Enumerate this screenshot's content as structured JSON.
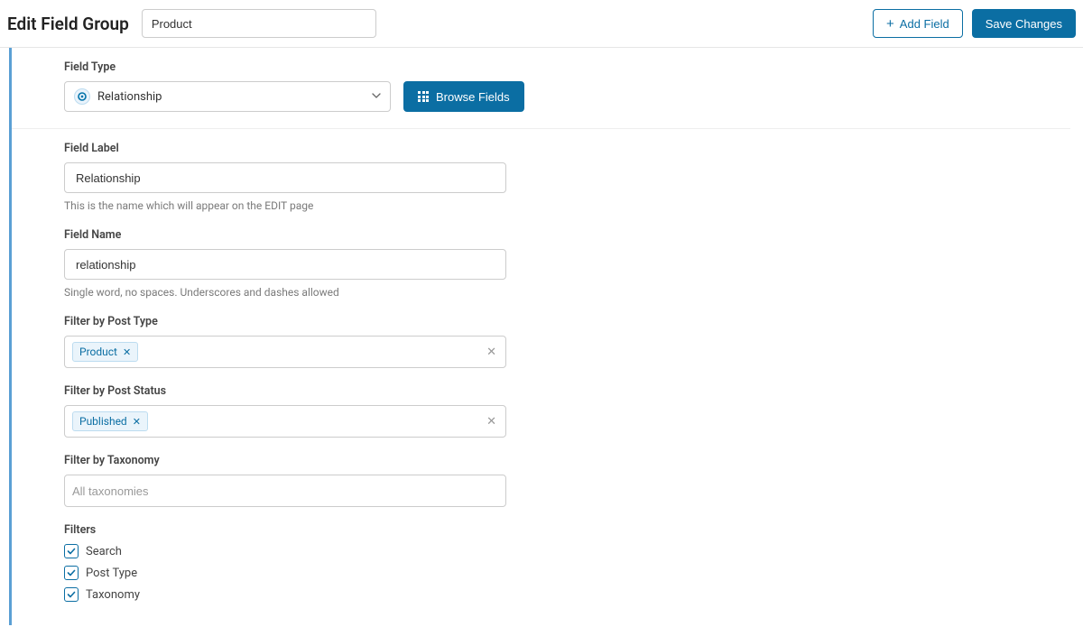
{
  "header": {
    "title": "Edit Field Group",
    "group_name": "Product",
    "add_field": "Add Field",
    "save_changes": "Save Changes"
  },
  "field_type": {
    "label": "Field Type",
    "selected": "Relationship",
    "browse": "Browse Fields"
  },
  "field_label": {
    "label": "Field Label",
    "value": "Relationship",
    "help": "This is the name which will appear on the EDIT page"
  },
  "field_name": {
    "label": "Field Name",
    "value": "relationship",
    "help": "Single word, no spaces. Underscores and dashes allowed"
  },
  "filter_post_type": {
    "label": "Filter by Post Type",
    "tags": [
      "Product"
    ]
  },
  "filter_post_status": {
    "label": "Filter by Post Status",
    "tags": [
      "Published"
    ]
  },
  "filter_taxonomy": {
    "label": "Filter by Taxonomy",
    "placeholder": "All taxonomies"
  },
  "filters": {
    "label": "Filters",
    "items": [
      "Search",
      "Post Type",
      "Taxonomy"
    ]
  }
}
